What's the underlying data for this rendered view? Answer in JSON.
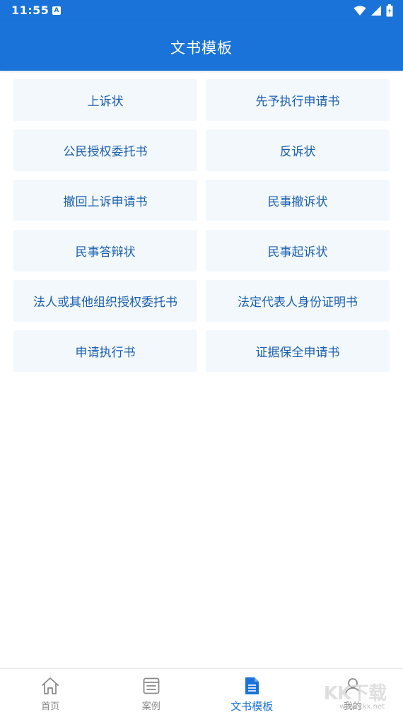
{
  "status_bar": {
    "time": "11:55",
    "notification_icon": "a-icon"
  },
  "app_bar": {
    "title": "文书模板"
  },
  "templates": [
    {
      "label": "上诉状"
    },
    {
      "label": "先予执行申请书"
    },
    {
      "label": "公民授权委托书"
    },
    {
      "label": "反诉状"
    },
    {
      "label": "撤回上诉申请书"
    },
    {
      "label": "民事撤诉状"
    },
    {
      "label": "民事答辩状"
    },
    {
      "label": "民事起诉状"
    },
    {
      "label": "法人或其他组织授权委托书"
    },
    {
      "label": "法定代表人身份证明书"
    },
    {
      "label": "申请执行书"
    },
    {
      "label": "证据保全申请书"
    }
  ],
  "bottom_nav": {
    "items": [
      {
        "label": "首页",
        "icon": "home-icon"
      },
      {
        "label": "案例",
        "icon": "case-icon"
      },
      {
        "label": "文书模板",
        "icon": "document-icon"
      },
      {
        "label": "我的",
        "icon": "profile-icon"
      }
    ],
    "active_index": 2
  },
  "watermark": {
    "text": "KK下载",
    "url": "www.kkx.net"
  },
  "colors": {
    "primary": "#1a73d9",
    "card_bg": "#f3f8fd",
    "card_text": "#1a5fae",
    "nav_inactive": "#888888"
  }
}
